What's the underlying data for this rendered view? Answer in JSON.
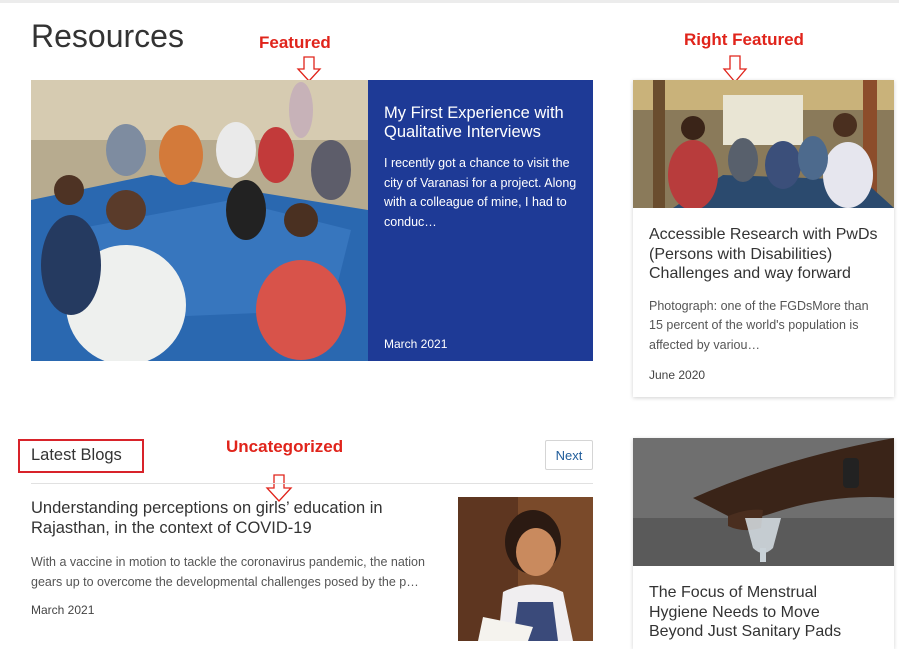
{
  "page": {
    "title": "Resources"
  },
  "annotations": {
    "featured": "Featured",
    "right_featured": "Right Featured",
    "uncategorized": "Uncategorized"
  },
  "featured": {
    "title": "My First Experience with Qualitative Interviews",
    "excerpt": "I recently got a chance to visit the city of Varanasi for a project. Along with a colleague of mine, I had to conduc…",
    "date": "March 2021",
    "panel_color": "#1e3a96"
  },
  "right_cards": [
    {
      "title": "Accessible Research with PwDs (Persons with Disabilities) Challenges and way forward",
      "excerpt": "Photograph: one of the FGDsMore than 15 percent  of the world's population is affected by variou…",
      "date": "June 2020"
    },
    {
      "title": "The Focus of Menstrual Hygiene Needs to Move Beyond Just Sanitary Pads"
    }
  ],
  "latest": {
    "label": "Latest Blogs",
    "next_label": "Next",
    "post": {
      "title": "Understanding perceptions on girls’ education in Rajasthan, in the context of COVID-19",
      "excerpt": "With a vaccine in motion to tackle the coronavirus pandemic, the nation gears up to overcome the developmental challenges posed by the p…",
      "date": "March 2021"
    }
  },
  "colors": {
    "annotation_red": "#e0241b",
    "link_blue": "#1f5c9a"
  }
}
